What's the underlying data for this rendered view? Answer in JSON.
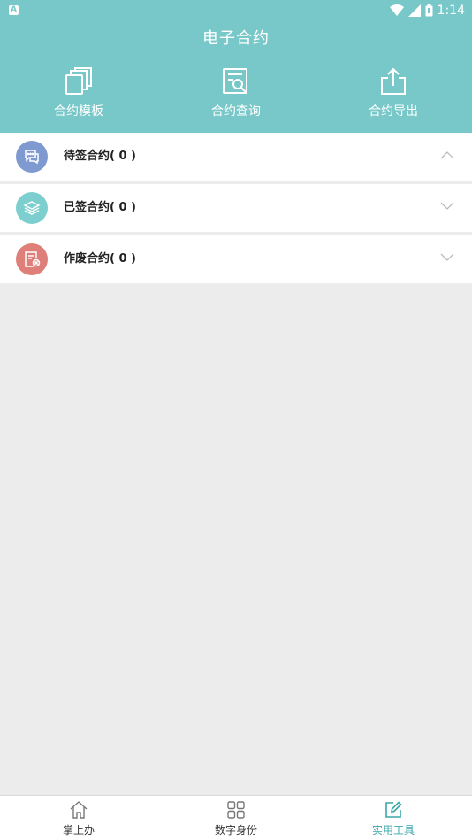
{
  "status_bar": {
    "time": "1:14"
  },
  "header": {
    "title": "电子合约"
  },
  "quick_actions": [
    {
      "label": "合约模板",
      "icon": "copy-icon"
    },
    {
      "label": "合约查询",
      "icon": "search-document-icon"
    },
    {
      "label": "合约导出",
      "icon": "export-icon"
    }
  ],
  "sections": [
    {
      "label": "待签合约",
      "count": "( 0 )",
      "icon": "chat-icon",
      "color": "#7f9ad0",
      "state": "expanded"
    },
    {
      "label": "已签合约",
      "count": "( 0 )",
      "icon": "layers-icon",
      "color": "#7ccfce",
      "state": "collapsed"
    },
    {
      "label": "作废合约",
      "count": "( 0 )",
      "icon": "void-document-icon",
      "color": "#df7f7a",
      "state": "collapsed"
    }
  ],
  "tabbar": {
    "items": [
      {
        "label": "掌上办",
        "icon": "home-icon"
      },
      {
        "label": "数字身份",
        "icon": "grid-icon"
      },
      {
        "label": "实用工具",
        "icon": "edit-icon"
      }
    ],
    "active_index": 2
  },
  "colors": {
    "header": "#79c8c9",
    "accent": "#3aa7a9",
    "background": "#ececec"
  }
}
